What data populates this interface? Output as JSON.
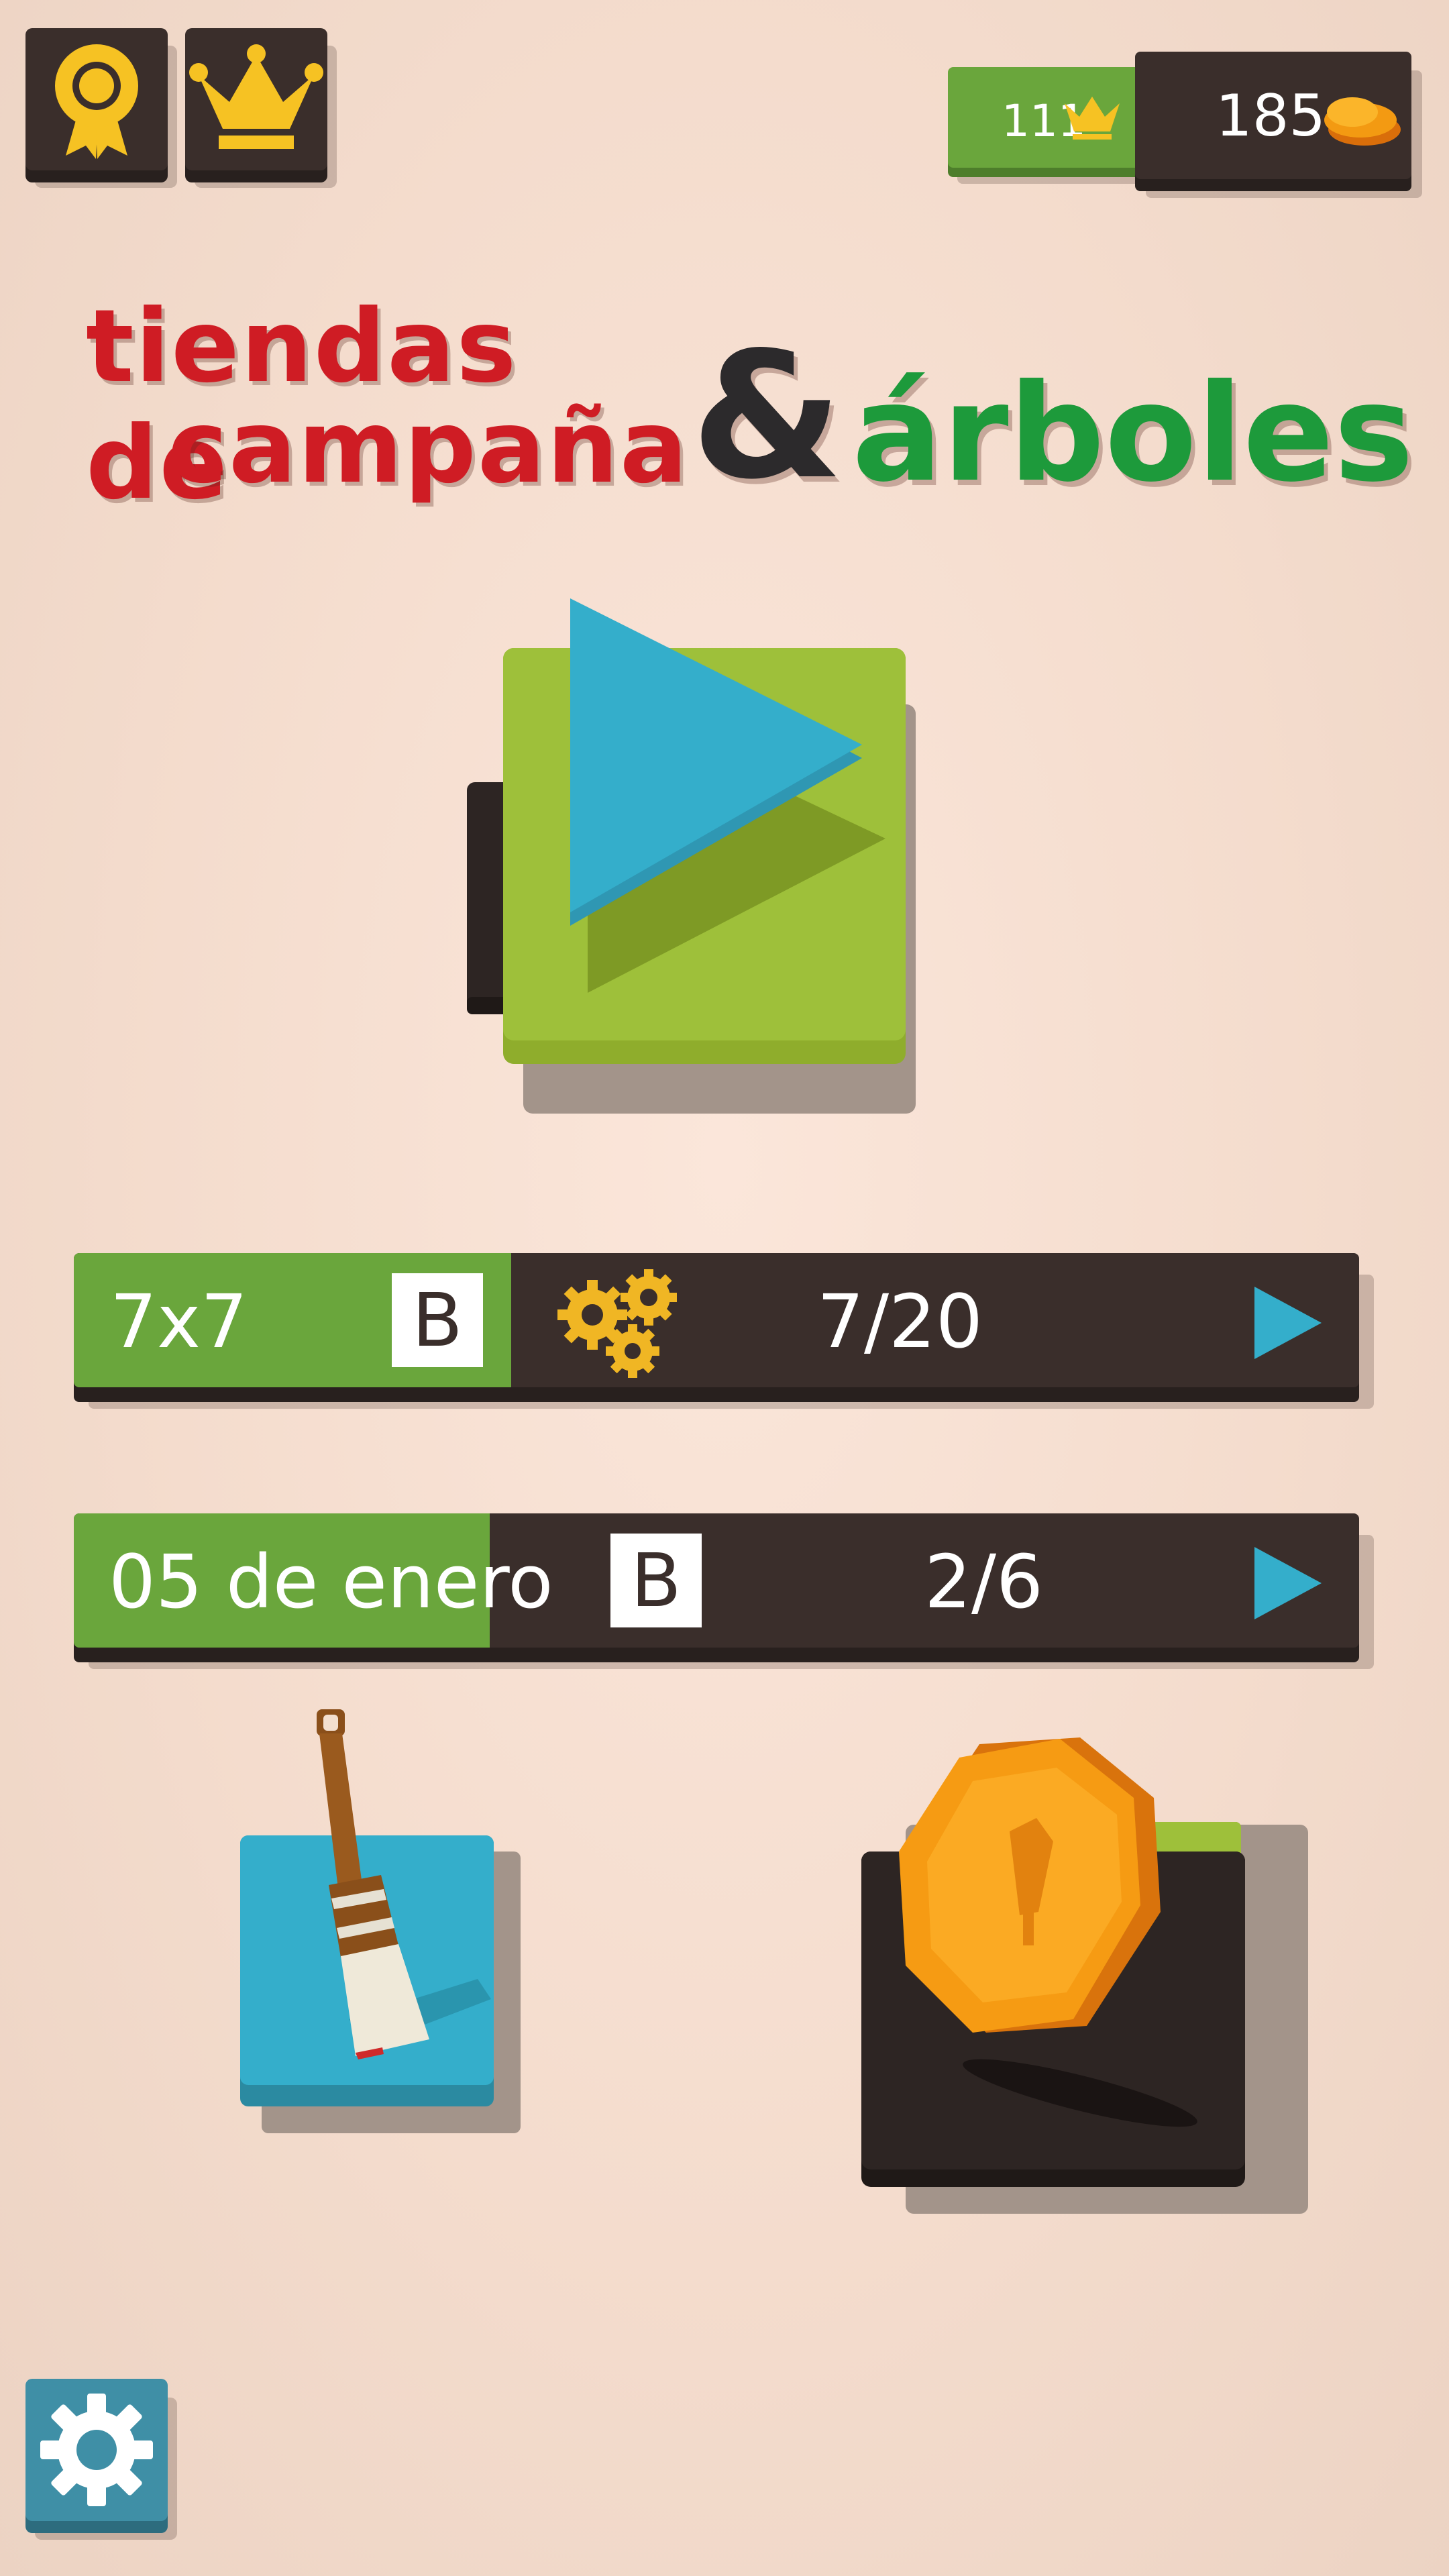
{
  "header": {
    "achievements_icon": "ribbon-award-icon",
    "leaderboard_icon": "crown-icon",
    "crowns": "111",
    "coins": "185"
  },
  "title": {
    "line1": "tiendas de",
    "line2": "campaña",
    "ampersand": "&",
    "word3": "árboles"
  },
  "play_icon": "play-icon",
  "level_bar": {
    "size": "7x7",
    "grade": "B",
    "icon": "gears-icon",
    "progress": "7/20"
  },
  "daily_bar": {
    "date": "05 de enero",
    "grade": "B",
    "progress": "2/6"
  },
  "tools": {
    "paint_icon": "paintbrush-icon",
    "shop_icon": "coin-icon"
  },
  "settings_icon": "gear-icon",
  "colors": {
    "dark": "#3a2e2b",
    "green": "#6aa63c",
    "blue": "#33adc9",
    "yellow": "#f6c223",
    "red": "#cf1c24",
    "title_green": "#1d9a3b"
  }
}
